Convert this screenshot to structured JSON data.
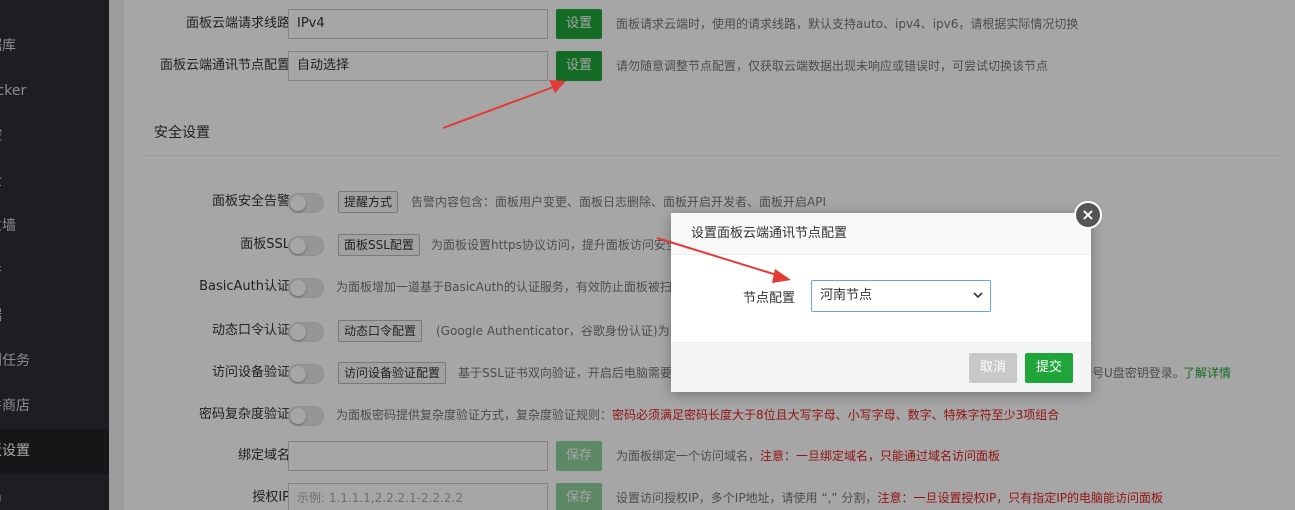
{
  "sidebar": {
    "items": [
      {
        "label": "P"
      },
      {
        "label": "据库"
      },
      {
        "label": "ocker"
      },
      {
        "label": "控"
      },
      {
        "label": "全"
      },
      {
        "label": "火墙"
      },
      {
        "label": "件"
      },
      {
        "label": "端"
      },
      {
        "label": "划任务"
      },
      {
        "label": "件商店"
      },
      {
        "label": "板设置"
      },
      {
        "label": "出"
      }
    ]
  },
  "settings": {
    "route": {
      "label": "面板云端请求线路",
      "value": "IPv4",
      "button": "设置",
      "tip": "面板请求云端时，使用的请求线路，默认支持auto、ipv4、ipv6，请根据实际情况切换"
    },
    "node": {
      "label": "面板云端通讯节点配置",
      "value": "自动选择",
      "button": "设置",
      "tip": "请勿随意调整节点配置，仅获取云端数据出现未响应或错误时，可尝试切换该节点"
    },
    "security_title": "安全设置",
    "alert": {
      "label": "面板安全告警",
      "button": "提醒方式",
      "tip": "告警内容包含：面板用户变更、面板日志删除、面板开启开发者、面板开启API"
    },
    "ssl": {
      "label": "面板SSL",
      "button": "面板SSL配置",
      "tip": "为面板设置https协议访问，提升面板访问安全"
    },
    "basicauth": {
      "label": "BasicAuth认证",
      "tip": "为面板增加一道基于BasicAuth的认证服务，有效防止面板被扫"
    },
    "dynamic": {
      "label": "动态口令认证",
      "button": "动态口令配置",
      "tip": "(Google Authenticator，谷歌身份认证)为面"
    },
    "device": {
      "label": "访问设备验证",
      "button": "访问设备验证配置",
      "tip": "基于SSL证书双向验证，开启后电脑需要",
      "tip_tail": "号U盘密钥登录。",
      "link": "了解详情"
    },
    "complexity": {
      "label": "密码复杂度验证",
      "tip": "为面板密码提供复杂度验证方式，复杂度验证规则：",
      "tip_red": "密码必须满足密码长度大于8位且大写字母、小写字母、数字、特殊字符至少3项组合"
    },
    "domain": {
      "label": "绑定域名",
      "value": "",
      "button": "保存",
      "tip": "为面板绑定一个访问域名，",
      "tip_red": "注意：一旦绑定域名，只能通过域名访问面板"
    },
    "authip": {
      "label": "授权IP",
      "placeholder": "示例: 1.1.1.1,2.2.2.1-2.2.2.2",
      "button": "保存",
      "tip": "设置访问授权IP，多个IP地址，请使用 “,” 分割，",
      "tip_red": "注意：一旦设置授权IP，只有指定IP的电脑能访问面板"
    }
  },
  "dialog": {
    "title": "设置面板云端通讯节点配置",
    "field_label": "节点配置",
    "selected": "河南节点",
    "cancel": "取消",
    "submit": "提交",
    "close_icon": "close-icon"
  },
  "colors": {
    "accent": "#20a53a",
    "annotation_arrow": "#e53935"
  }
}
